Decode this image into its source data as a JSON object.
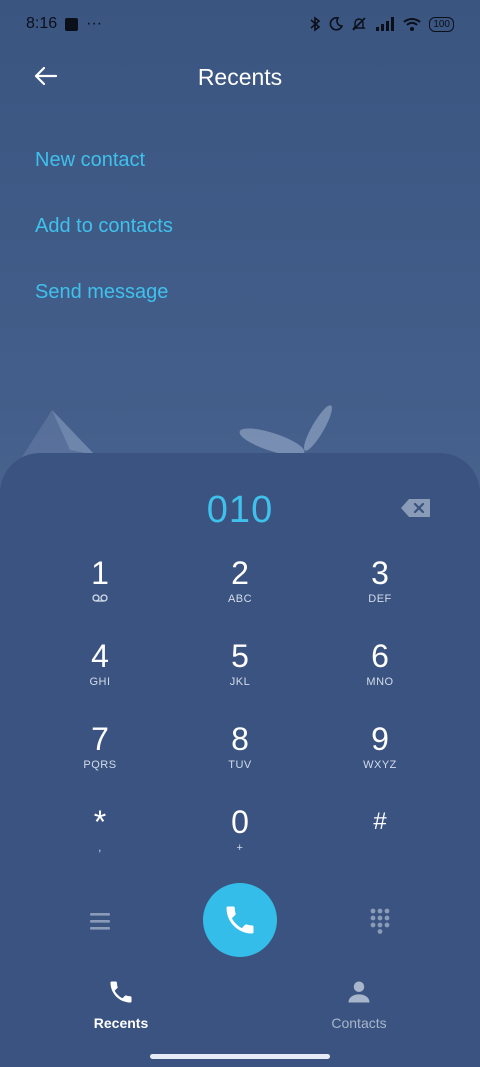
{
  "status_bar": {
    "time": "8:16",
    "dots": "···",
    "battery": "100"
  },
  "header": {
    "title": "Recents"
  },
  "actions": [
    "New contact",
    "Add to contacts",
    "Send message"
  ],
  "dialer": {
    "number": "010",
    "keys": [
      {
        "digit": "1",
        "letters": ""
      },
      {
        "digit": "2",
        "letters": "ABC"
      },
      {
        "digit": "3",
        "letters": "DEF"
      },
      {
        "digit": "4",
        "letters": "GHI"
      },
      {
        "digit": "5",
        "letters": "JKL"
      },
      {
        "digit": "6",
        "letters": "MNO"
      },
      {
        "digit": "7",
        "letters": "PQRS"
      },
      {
        "digit": "8",
        "letters": "TUV"
      },
      {
        "digit": "9",
        "letters": "WXYZ"
      },
      {
        "digit": "*",
        "letters": ","
      },
      {
        "digit": "0",
        "letters": "+"
      },
      {
        "digit": "#",
        "letters": ""
      }
    ]
  },
  "nav": {
    "recents_label": "Recents",
    "contacts_label": "Contacts"
  },
  "colors": {
    "accent": "#3fc1ec",
    "call_button": "#35bde9",
    "background": "#3a5380"
  }
}
